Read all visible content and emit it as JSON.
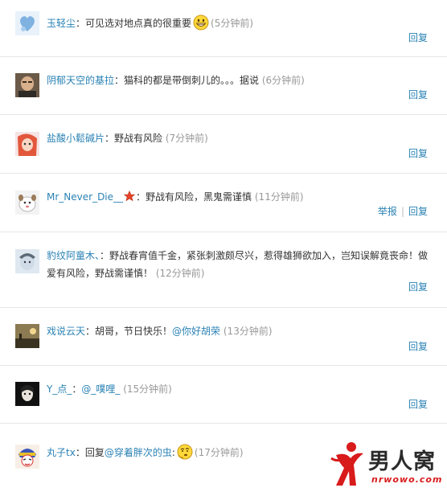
{
  "comments": [
    {
      "user": "玉轻尘",
      "text": "：可见选对地点真的很重要",
      "emoji": "grin-emoji",
      "time": "(5分钟前)",
      "reply": "回复"
    },
    {
      "user": "阴郁天空的基拉",
      "text": "：猫科的都是带倒刺儿的。。。据说",
      "time": "(6分钟前)",
      "reply": "回复"
    },
    {
      "user": "盐酸小鬆碱片",
      "text": "：野战有风险",
      "time": "(7分钟前)",
      "reply": "回复"
    },
    {
      "user": "Mr_Never_Die__",
      "badge": "star-icon",
      "text": "：野战有风险，黑鬼需谨慎",
      "time": "(11分钟前)",
      "report": "举报",
      "reply": "回复"
    },
    {
      "user": "豹纹阿童木、",
      "text": "：野战春宵值千金，紧张刺激颇尽兴，惹得雄狮欲加入，岂知误解竟丧命！做爱有风险，野战需谨慎！",
      "time": "(12分钟前)",
      "reply": "回复"
    },
    {
      "user": "戏说云天",
      "text": "：胡哥，节日快乐！",
      "mention": "@你好胡荣",
      "time": "(13分钟前)",
      "reply": "回复"
    },
    {
      "user": "Y_点_",
      "text": "：",
      "mention": "@_噗哩_",
      "time": "(15分钟前)",
      "reply": "回复"
    },
    {
      "user": "丸子tx",
      "text": "：回复",
      "mention": "@穿着胖次的虫",
      "text2": ":",
      "emoji": "thinking-emoji",
      "time": "(17分钟前)"
    }
  ],
  "watermark": {
    "title": "男人窝",
    "url": "nrwowo.com"
  },
  "colors": {
    "link": "#2a82b4",
    "muted": "#999999",
    "divider": "#e6e6e6",
    "watermark_red": "#d81b1b"
  }
}
